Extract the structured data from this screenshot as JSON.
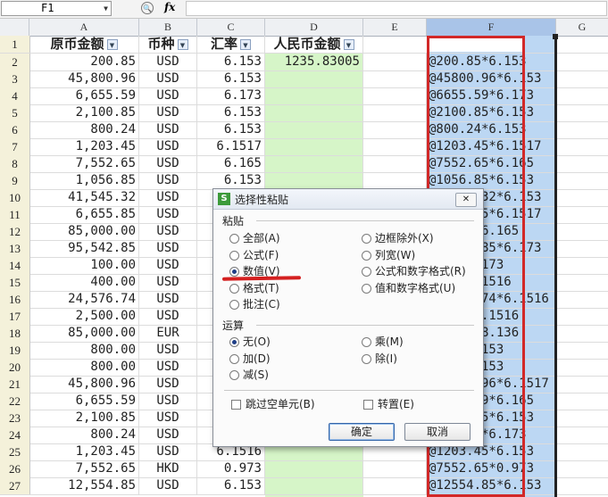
{
  "formula_bar": {
    "cell_ref": "F1",
    "zoom_glyph": "🔍",
    "fx_label": "fx",
    "formula": ""
  },
  "columns": [
    "A",
    "B",
    "C",
    "D",
    "E",
    "F",
    "G"
  ],
  "headers": {
    "a": "原币金额",
    "b": "币种",
    "c": "汇率",
    "d": "人民币金额"
  },
  "filter_glyph": "▼",
  "rows": [
    {
      "n": "2",
      "a": "200.85",
      "b": "USD",
      "c": "6.153",
      "d": "1235.83005",
      "f": "@200.85*6.153"
    },
    {
      "n": "3",
      "a": "45,800.96",
      "b": "USD",
      "c": "6.153",
      "d": "",
      "f": "@45800.96*6.153"
    },
    {
      "n": "4",
      "a": "6,655.59",
      "b": "USD",
      "c": "6.173",
      "d": "",
      "f": "@6655.59*6.173"
    },
    {
      "n": "5",
      "a": "2,100.85",
      "b": "USD",
      "c": "6.153",
      "d": "",
      "f": "@2100.85*6.153"
    },
    {
      "n": "6",
      "a": "800.24",
      "b": "USD",
      "c": "6.153",
      "d": "",
      "f": "@800.24*6.153"
    },
    {
      "n": "7",
      "a": "1,203.45",
      "b": "USD",
      "c": "6.1517",
      "d": "",
      "f": "@1203.45*6.1517"
    },
    {
      "n": "8",
      "a": "7,552.65",
      "b": "USD",
      "c": "6.165",
      "d": "",
      "f": "@7552.65*6.165"
    },
    {
      "n": "9",
      "a": "1,056.85",
      "b": "USD",
      "c": "6.153",
      "d": "",
      "f": "@1056.85*6.153"
    },
    {
      "n": "10",
      "a": "41,545.32",
      "b": "USD",
      "c": "6.153",
      "d": "",
      "f": "@41545.32*6.153"
    },
    {
      "n": "11",
      "a": "6,655.85",
      "b": "USD",
      "c": "6.153",
      "d": "",
      "f": "@6655.85*6.1517"
    },
    {
      "n": "12",
      "a": "85,000.00",
      "b": "USD",
      "c": "6.153",
      "d": "",
      "f": "@85000*6.165"
    },
    {
      "n": "13",
      "a": "95,542.85",
      "b": "USD",
      "c": "6.153",
      "d": "",
      "f": "@95542.85*6.173"
    },
    {
      "n": "14",
      "a": "100.00",
      "b": "USD",
      "c": "6.153",
      "d": "",
      "f": "@100*6.173"
    },
    {
      "n": "15",
      "a": "400.00",
      "b": "USD",
      "c": "6.153",
      "d": "",
      "f": "@400*6.1516"
    },
    {
      "n": "16",
      "a": "24,576.74",
      "b": "USD",
      "c": "6.153",
      "d": "",
      "f": "@24576.74*6.1516"
    },
    {
      "n": "17",
      "a": "2,500.00",
      "b": "USD",
      "c": "6.153",
      "d": "",
      "f": "@2500*6.1516"
    },
    {
      "n": "18",
      "a": "85,000.00",
      "b": "EUR",
      "c": "6.153",
      "d": "",
      "f": "@85000*8.136"
    },
    {
      "n": "19",
      "a": "800.00",
      "b": "USD",
      "c": "6.153",
      "d": "",
      "f": "@800*6.153"
    },
    {
      "n": "20",
      "a": "800.00",
      "b": "USD",
      "c": "6.153",
      "d": "",
      "f": "@800*6.153"
    },
    {
      "n": "21",
      "a": "45,800.96",
      "b": "USD",
      "c": "6.153",
      "d": "",
      "f": "@45800.96*6.1517"
    },
    {
      "n": "22",
      "a": "6,655.59",
      "b": "USD",
      "c": "6.153",
      "d": "",
      "f": "@6655.59*6.165"
    },
    {
      "n": "23",
      "a": "2,100.85",
      "b": "USD",
      "c": "6.153",
      "d": "",
      "f": "@2100.85*6.153"
    },
    {
      "n": "24",
      "a": "800.24",
      "b": "USD",
      "c": "6.153",
      "d": "",
      "f": "@800.24*6.173"
    },
    {
      "n": "25",
      "a": "1,203.45",
      "b": "USD",
      "c": "6.1516",
      "d": "",
      "f": "@1203.45*6.153"
    },
    {
      "n": "26",
      "a": "7,552.65",
      "b": "HKD",
      "c": "0.973",
      "d": "",
      "f": "@7552.65*0.973"
    },
    {
      "n": "27",
      "a": "12,554.85",
      "b": "USD",
      "c": "6.153",
      "d": "",
      "f": "@12554.85*6.153"
    }
  ],
  "dialog": {
    "title": "选择性粘贴",
    "logo": "S",
    "close_glyph": "✕",
    "paste_section": "粘贴",
    "paste_options": [
      {
        "label": "全部(A)",
        "selected": false
      },
      {
        "label": "公式(F)",
        "selected": false
      },
      {
        "label": "数值(V)",
        "selected": true
      },
      {
        "label": "格式(T)",
        "selected": false
      },
      {
        "label": "批注(C)",
        "selected": false
      }
    ],
    "paste_options_right": [
      {
        "label": "边框除外(X)",
        "selected": false
      },
      {
        "label": "列宽(W)",
        "selected": false
      },
      {
        "label": "公式和数字格式(R)",
        "selected": false
      },
      {
        "label": "值和数字格式(U)",
        "selected": false
      }
    ],
    "operation_section": "运算",
    "operation_left": [
      {
        "label": "无(O)",
        "selected": true
      },
      {
        "label": "加(D)",
        "selected": false
      },
      {
        "label": "减(S)",
        "selected": false
      }
    ],
    "operation_right": [
      {
        "label": "乘(M)",
        "selected": false
      },
      {
        "label": "除(I)",
        "selected": false
      }
    ],
    "skip_blanks": "跳过空单元(B)",
    "transpose": "转置(E)",
    "ok": "确定",
    "cancel": "取消"
  },
  "colors": {
    "selection_border": "#d22828",
    "column_d": "#d6f5c8",
    "column_f": "#bcd7f3"
  }
}
